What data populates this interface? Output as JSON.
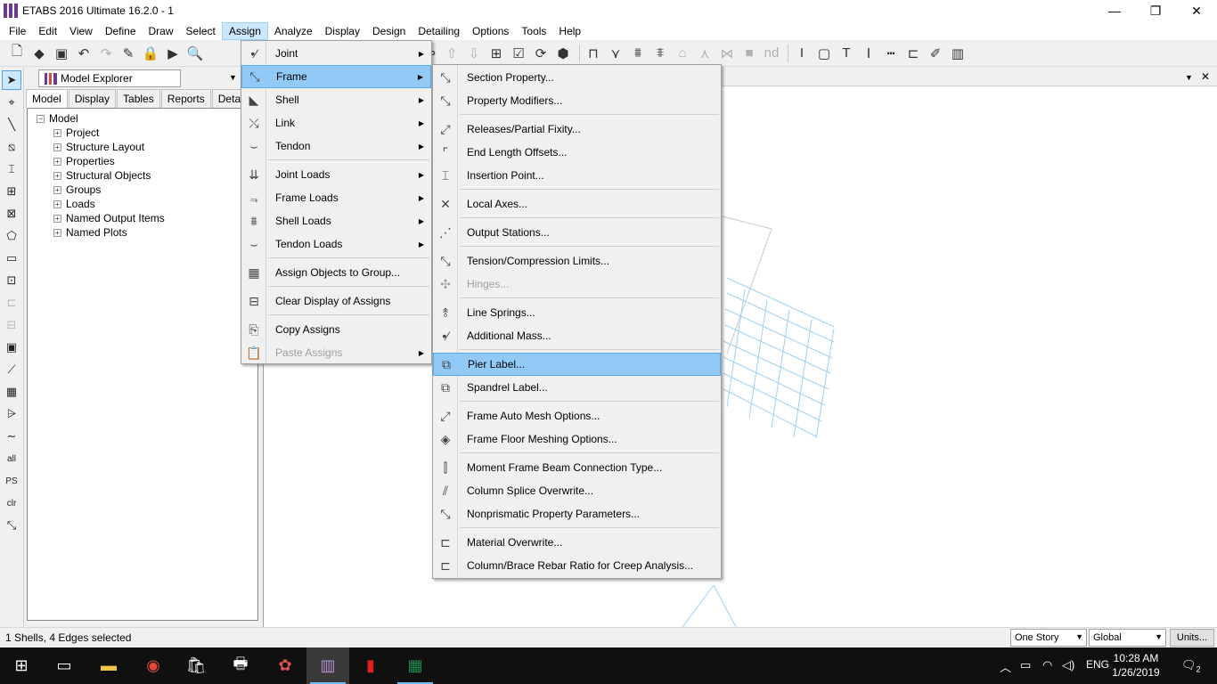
{
  "window": {
    "title": "ETABS 2016 Ultimate 16.2.0 - 1",
    "min": "—",
    "max": "❐",
    "close": "✕"
  },
  "menubar": [
    "File",
    "Edit",
    "View",
    "Define",
    "Draw",
    "Select",
    "Assign",
    "Analyze",
    "Display",
    "Design",
    "Detailing",
    "Options",
    "Tools",
    "Help"
  ],
  "toolbar": {
    "label_nd": "nd"
  },
  "explorer": {
    "title": "Model Explorer",
    "tabs": [
      "Model",
      "Display",
      "Tables",
      "Reports",
      "Detailing"
    ],
    "tree": {
      "root": "Model",
      "children": [
        "Project",
        "Structure Layout",
        "Properties",
        "Structural Objects",
        "Groups",
        "Loads",
        "Named Output Items",
        "Named Plots"
      ]
    }
  },
  "lefttools": {
    "all": "all",
    "ps": "PS",
    "clr": "clr"
  },
  "assign_menu": {
    "items": [
      "Joint",
      "Frame",
      "Shell",
      "Link",
      "Tendon",
      "Joint Loads",
      "Frame Loads",
      "Shell Loads",
      "Tendon Loads",
      "Assign Objects to Group...",
      "Clear Display of Assigns",
      "Copy Assigns",
      "Paste Assigns"
    ]
  },
  "frame_menu": {
    "items": [
      "Section Property...",
      "Property Modifiers...",
      "Releases/Partial Fixity...",
      "End Length Offsets...",
      "Insertion Point...",
      "Local Axes...",
      "Output Stations...",
      "Tension/Compression Limits...",
      "Hinges...",
      "Line Springs...",
      "Additional Mass...",
      "Pier Label...",
      "Spandrel Label...",
      "Frame Auto Mesh Options...",
      "Frame Floor Meshing Options...",
      "Moment Frame Beam Connection Type...",
      "Column Splice Overwrite...",
      "Nonprismatic Property Parameters...",
      "Material Overwrite...",
      "Column/Brace Rebar Ratio for Creep Analysis..."
    ]
  },
  "statusbar": {
    "text": "1 Shells, 4 Edges selected",
    "story": "One Story",
    "coord": "Global",
    "units": "Units..."
  },
  "taskbar": {
    "lang": "ENG",
    "time": "10:28 AM",
    "date": "1/26/2019",
    "notifications": "2"
  },
  "colors": {
    "menu_highlight": "#91c9f7",
    "grid_lines": "#9fd0f0",
    "outline_lines": "#c8c8c8"
  }
}
